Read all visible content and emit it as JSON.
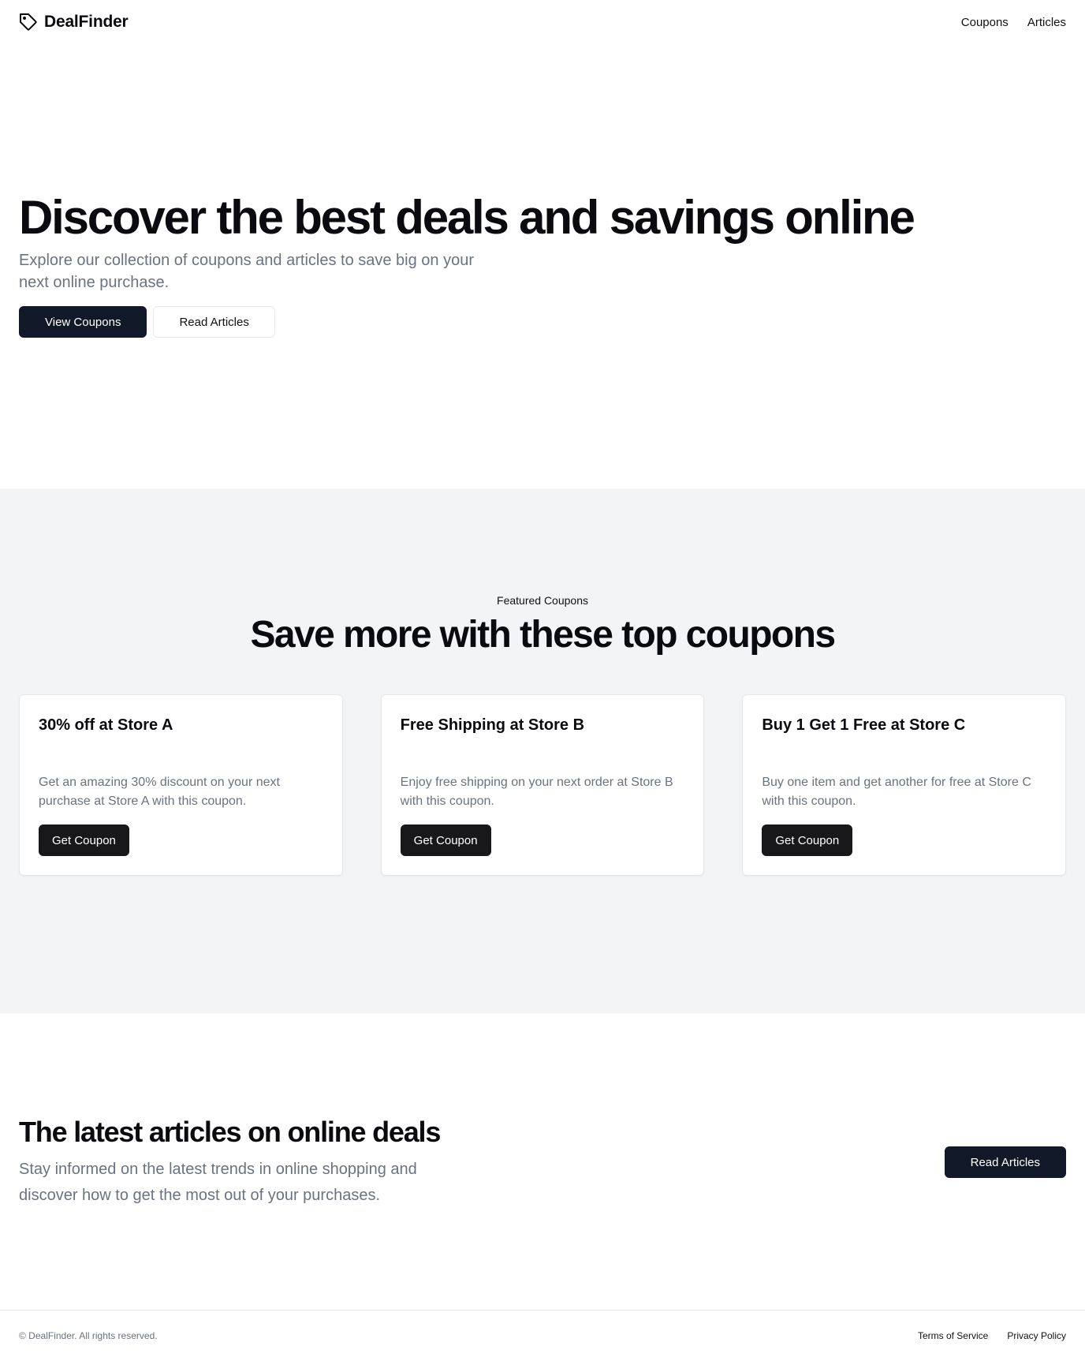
{
  "header": {
    "brand": "DealFinder",
    "brand_icon": "tag-icon",
    "nav": [
      {
        "label": "Coupons"
      },
      {
        "label": "Articles"
      }
    ]
  },
  "hero": {
    "title": "Discover the best deals and savings online",
    "subtitle": "Explore our collection of coupons and articles to save big on your next online purchase.",
    "primary_button": "View Coupons",
    "secondary_button": "Read Articles"
  },
  "coupons": {
    "eyebrow": "Featured Coupons",
    "title": "Save more with these top coupons",
    "cards": [
      {
        "title": "30% off at Store A",
        "description": "Get an amazing 30% discount on your next purchase at Store A with this coupon.",
        "button": "Get Coupon"
      },
      {
        "title": "Free Shipping at Store B",
        "description": "Enjoy free shipping on your next order at Store B with this coupon.",
        "button": "Get Coupon"
      },
      {
        "title": "Buy 1 Get 1 Free at Store C",
        "description": "Buy one item and get another for free at Store C with this coupon.",
        "button": "Get Coupon"
      }
    ]
  },
  "articles": {
    "title": "The latest articles on online deals",
    "subtitle": "Stay informed on the latest trends in online shopping and discover how to get the most out of your purchases.",
    "button": "Read Articles"
  },
  "footer": {
    "copyright": "© DealFinder. All rights reserved.",
    "links": [
      {
        "label": "Terms of Service"
      },
      {
        "label": "Privacy Policy"
      }
    ]
  },
  "colors": {
    "primary": "#111827",
    "muted_text": "#6b7280",
    "section_bg": "#f3f4f6",
    "border": "#e5e7eb"
  }
}
